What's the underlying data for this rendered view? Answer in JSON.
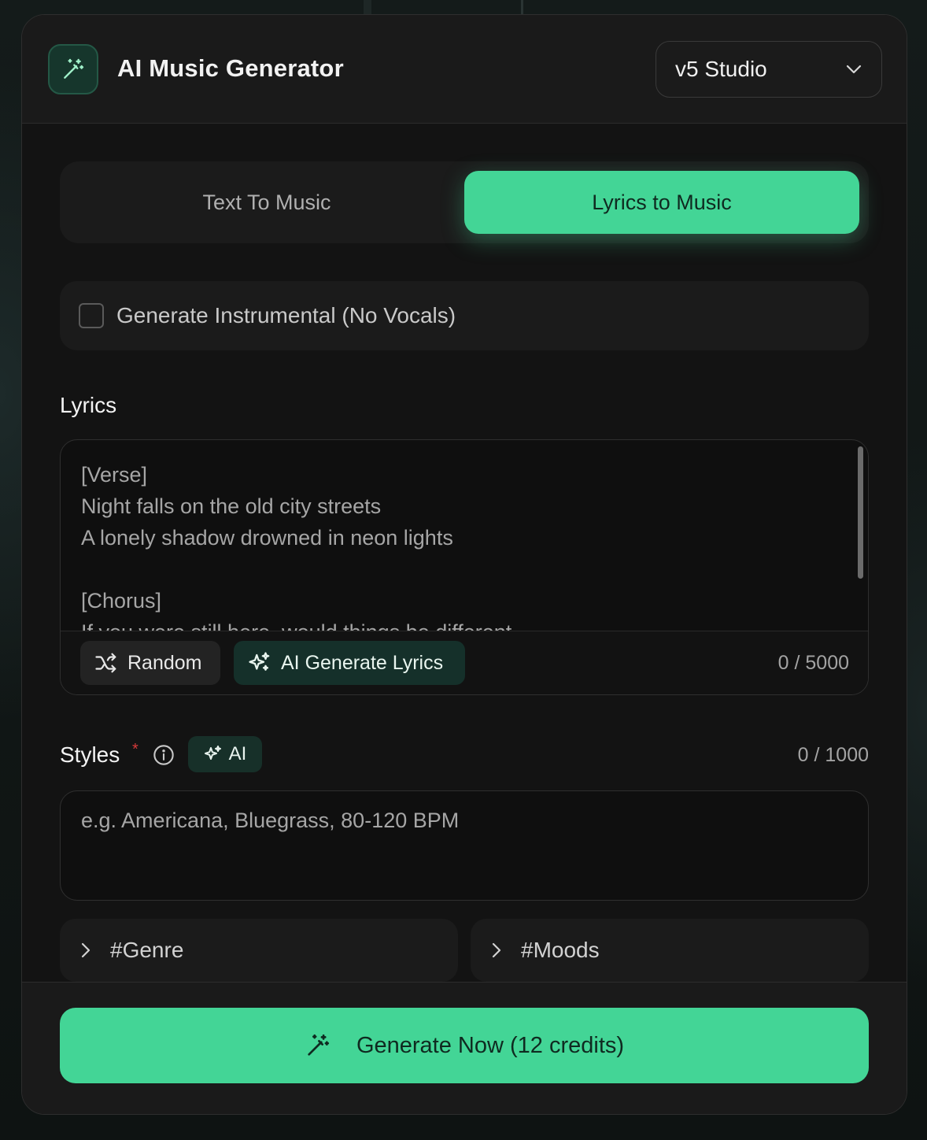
{
  "header": {
    "title": "AI Music Generator",
    "logo_icon": "magic-wand-icon",
    "model_select": {
      "selected": "v5 Studio",
      "icon": "chevron-down-icon"
    }
  },
  "mode_tabs": [
    {
      "label": "Text To Music",
      "active": false
    },
    {
      "label": "Lyrics to Music",
      "active": true
    }
  ],
  "instrumental": {
    "label": "Generate Instrumental (No Vocals)",
    "checked": false
  },
  "lyrics": {
    "label": "Lyrics",
    "text": "[Verse]\nNight falls on the old city streets\nA lonely shadow drowned in neon lights\n\n[Chorus]\nIf you were still here, would things be different",
    "random_label": "Random",
    "ai_generate_label": "AI Generate Lyrics",
    "counter": "0 / 5000"
  },
  "styles": {
    "label": "Styles",
    "required_mark": "*",
    "ai_chip_label": "AI",
    "counter": "0 / 1000",
    "placeholder": "e.g. Americana, Bluegrass, 80-120 BPM"
  },
  "tags": {
    "genre_label": "#Genre",
    "moods_label": "#Moods"
  },
  "generate": {
    "label": "Generate Now (12 credits)"
  },
  "colors": {
    "accent": "#43d596",
    "panel": "#131313",
    "required": "#d63a3a"
  }
}
